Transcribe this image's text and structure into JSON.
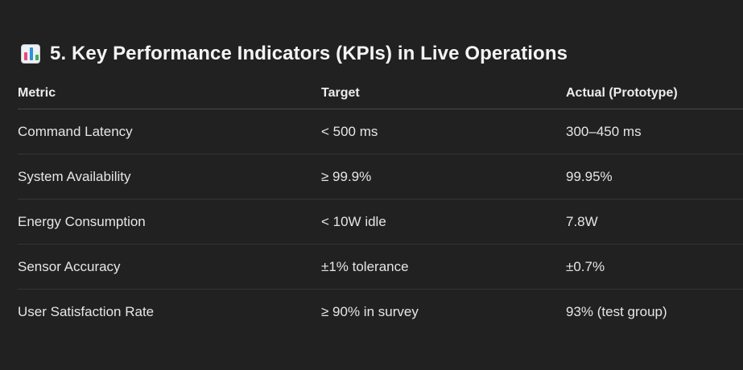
{
  "section": {
    "heading": "5. Key Performance Indicators (KPIs) in Live Operations",
    "icon": "bar-chart-icon"
  },
  "table": {
    "headers": [
      "Metric",
      "Target",
      "Actual (Prototype)"
    ],
    "rows": [
      [
        "Command Latency",
        "< 500 ms",
        "300–450 ms"
      ],
      [
        "System Availability",
        "≥ 99.9%",
        "99.95%"
      ],
      [
        "Energy Consumption",
        "< 10W idle",
        "7.8W"
      ],
      [
        "Sensor Accuracy",
        "±1% tolerance",
        "±0.7%"
      ],
      [
        "User Satisfaction Rate",
        "≥ 90% in survey",
        "93% (test group)"
      ]
    ]
  },
  "colors": {
    "background": "#212121",
    "text": "#ececec",
    "divider": "#353535"
  }
}
